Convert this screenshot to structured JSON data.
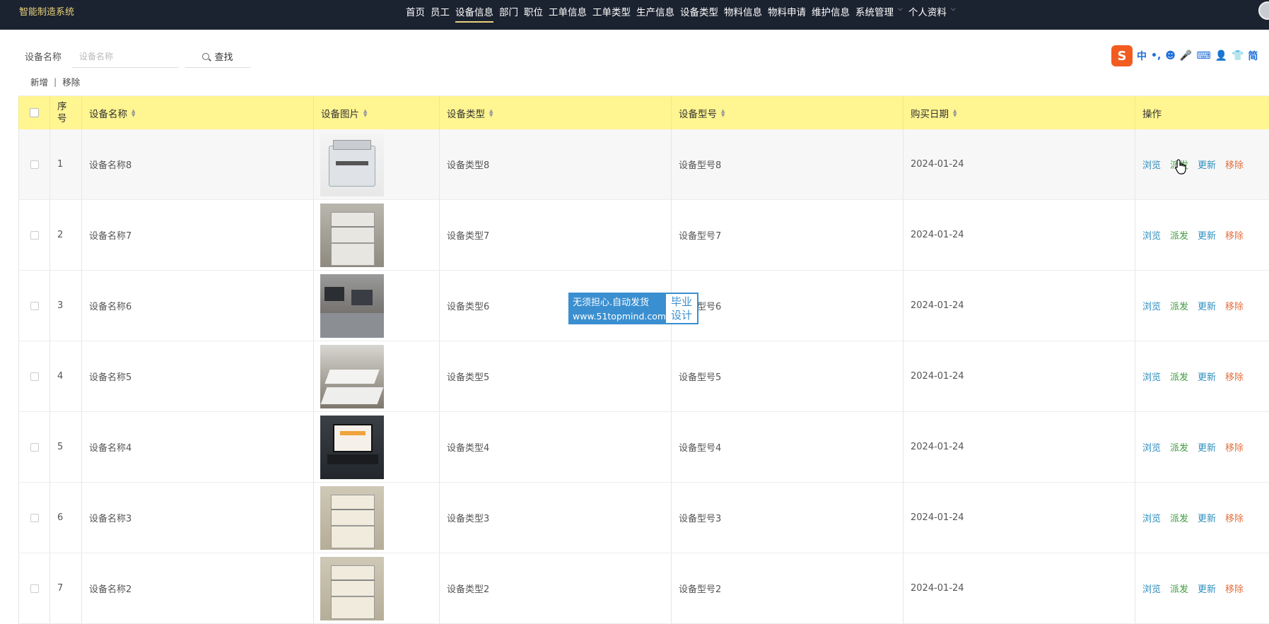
{
  "app": {
    "title": "智能制造系统"
  },
  "nav": {
    "items": [
      {
        "label": "首页",
        "active": false,
        "dropdown": false
      },
      {
        "label": "员工",
        "active": false,
        "dropdown": false
      },
      {
        "label": "设备信息",
        "active": true,
        "dropdown": false
      },
      {
        "label": "部门",
        "active": false,
        "dropdown": false
      },
      {
        "label": "职位",
        "active": false,
        "dropdown": false
      },
      {
        "label": "工单信息",
        "active": false,
        "dropdown": false
      },
      {
        "label": "工单类型",
        "active": false,
        "dropdown": false
      },
      {
        "label": "生产信息",
        "active": false,
        "dropdown": false
      },
      {
        "label": "设备类型",
        "active": false,
        "dropdown": false
      },
      {
        "label": "物料信息",
        "active": false,
        "dropdown": false
      },
      {
        "label": "物料申请",
        "active": false,
        "dropdown": false
      },
      {
        "label": "维护信息",
        "active": false,
        "dropdown": false
      },
      {
        "label": "系统管理",
        "active": false,
        "dropdown": true
      },
      {
        "label": "个人资料",
        "active": false,
        "dropdown": true
      }
    ]
  },
  "search": {
    "label": "设备名称",
    "placeholder": "设备名称",
    "value": "",
    "button": "查找"
  },
  "actions": {
    "add": "新增",
    "separator": "|",
    "remove": "移除"
  },
  "ime": {
    "logo": "S",
    "items": [
      "中",
      "•,",
      "☻",
      "🎤",
      "⌨",
      "👤",
      "👕",
      "简"
    ]
  },
  "table": {
    "headers": {
      "seq": "序\n号",
      "name": "设备名称",
      "image": "设备图片",
      "type": "设备类型",
      "model": "设备型号",
      "date": "购买日期",
      "ops": "操作"
    },
    "row_actions": {
      "view": "浏览",
      "dispatch": "派发",
      "update": "更新",
      "remove": "移除"
    },
    "rows": [
      {
        "seq": "1",
        "name": "设备名称8",
        "type": "设备类型8",
        "model": "设备型号8",
        "date": "2024-01-24",
        "image": "printer"
      },
      {
        "seq": "2",
        "name": "设备名称7",
        "type": "设备类型7",
        "model": "设备型号7",
        "date": "2024-01-24",
        "image": "copier"
      },
      {
        "seq": "3",
        "name": "设备名称6",
        "type": "设备类型6",
        "model": "设备型号6",
        "date": "2024-01-24",
        "image": "computer-lab"
      },
      {
        "seq": "4",
        "name": "设备名称5",
        "type": "设备类型5",
        "model": "设备型号5",
        "date": "2024-01-24",
        "image": "meeting-room"
      },
      {
        "seq": "5",
        "name": "设备名称4",
        "type": "设备类型4",
        "model": "设备型号4",
        "date": "2024-01-24",
        "image": "laptop"
      },
      {
        "seq": "6",
        "name": "设备名称3",
        "type": "设备类型3",
        "model": "设备型号3",
        "date": "2024-01-24",
        "image": "copier-beige"
      },
      {
        "seq": "7",
        "name": "设备名称2",
        "type": "设备类型2",
        "model": "设备型号2",
        "date": "2024-01-24",
        "image": "copier-beige"
      }
    ]
  },
  "watermark": {
    "line1": "无须担心.自动发货",
    "line2": "www.51topmind.com",
    "right1": "毕业",
    "right2": "设计"
  },
  "colors": {
    "topbar": "#1b2230",
    "brand": "#e8d27a",
    "header_row": "#fff591",
    "view": "#2f8fbf",
    "dispatch": "#3f9a3f",
    "remove": "#e46f3d"
  }
}
